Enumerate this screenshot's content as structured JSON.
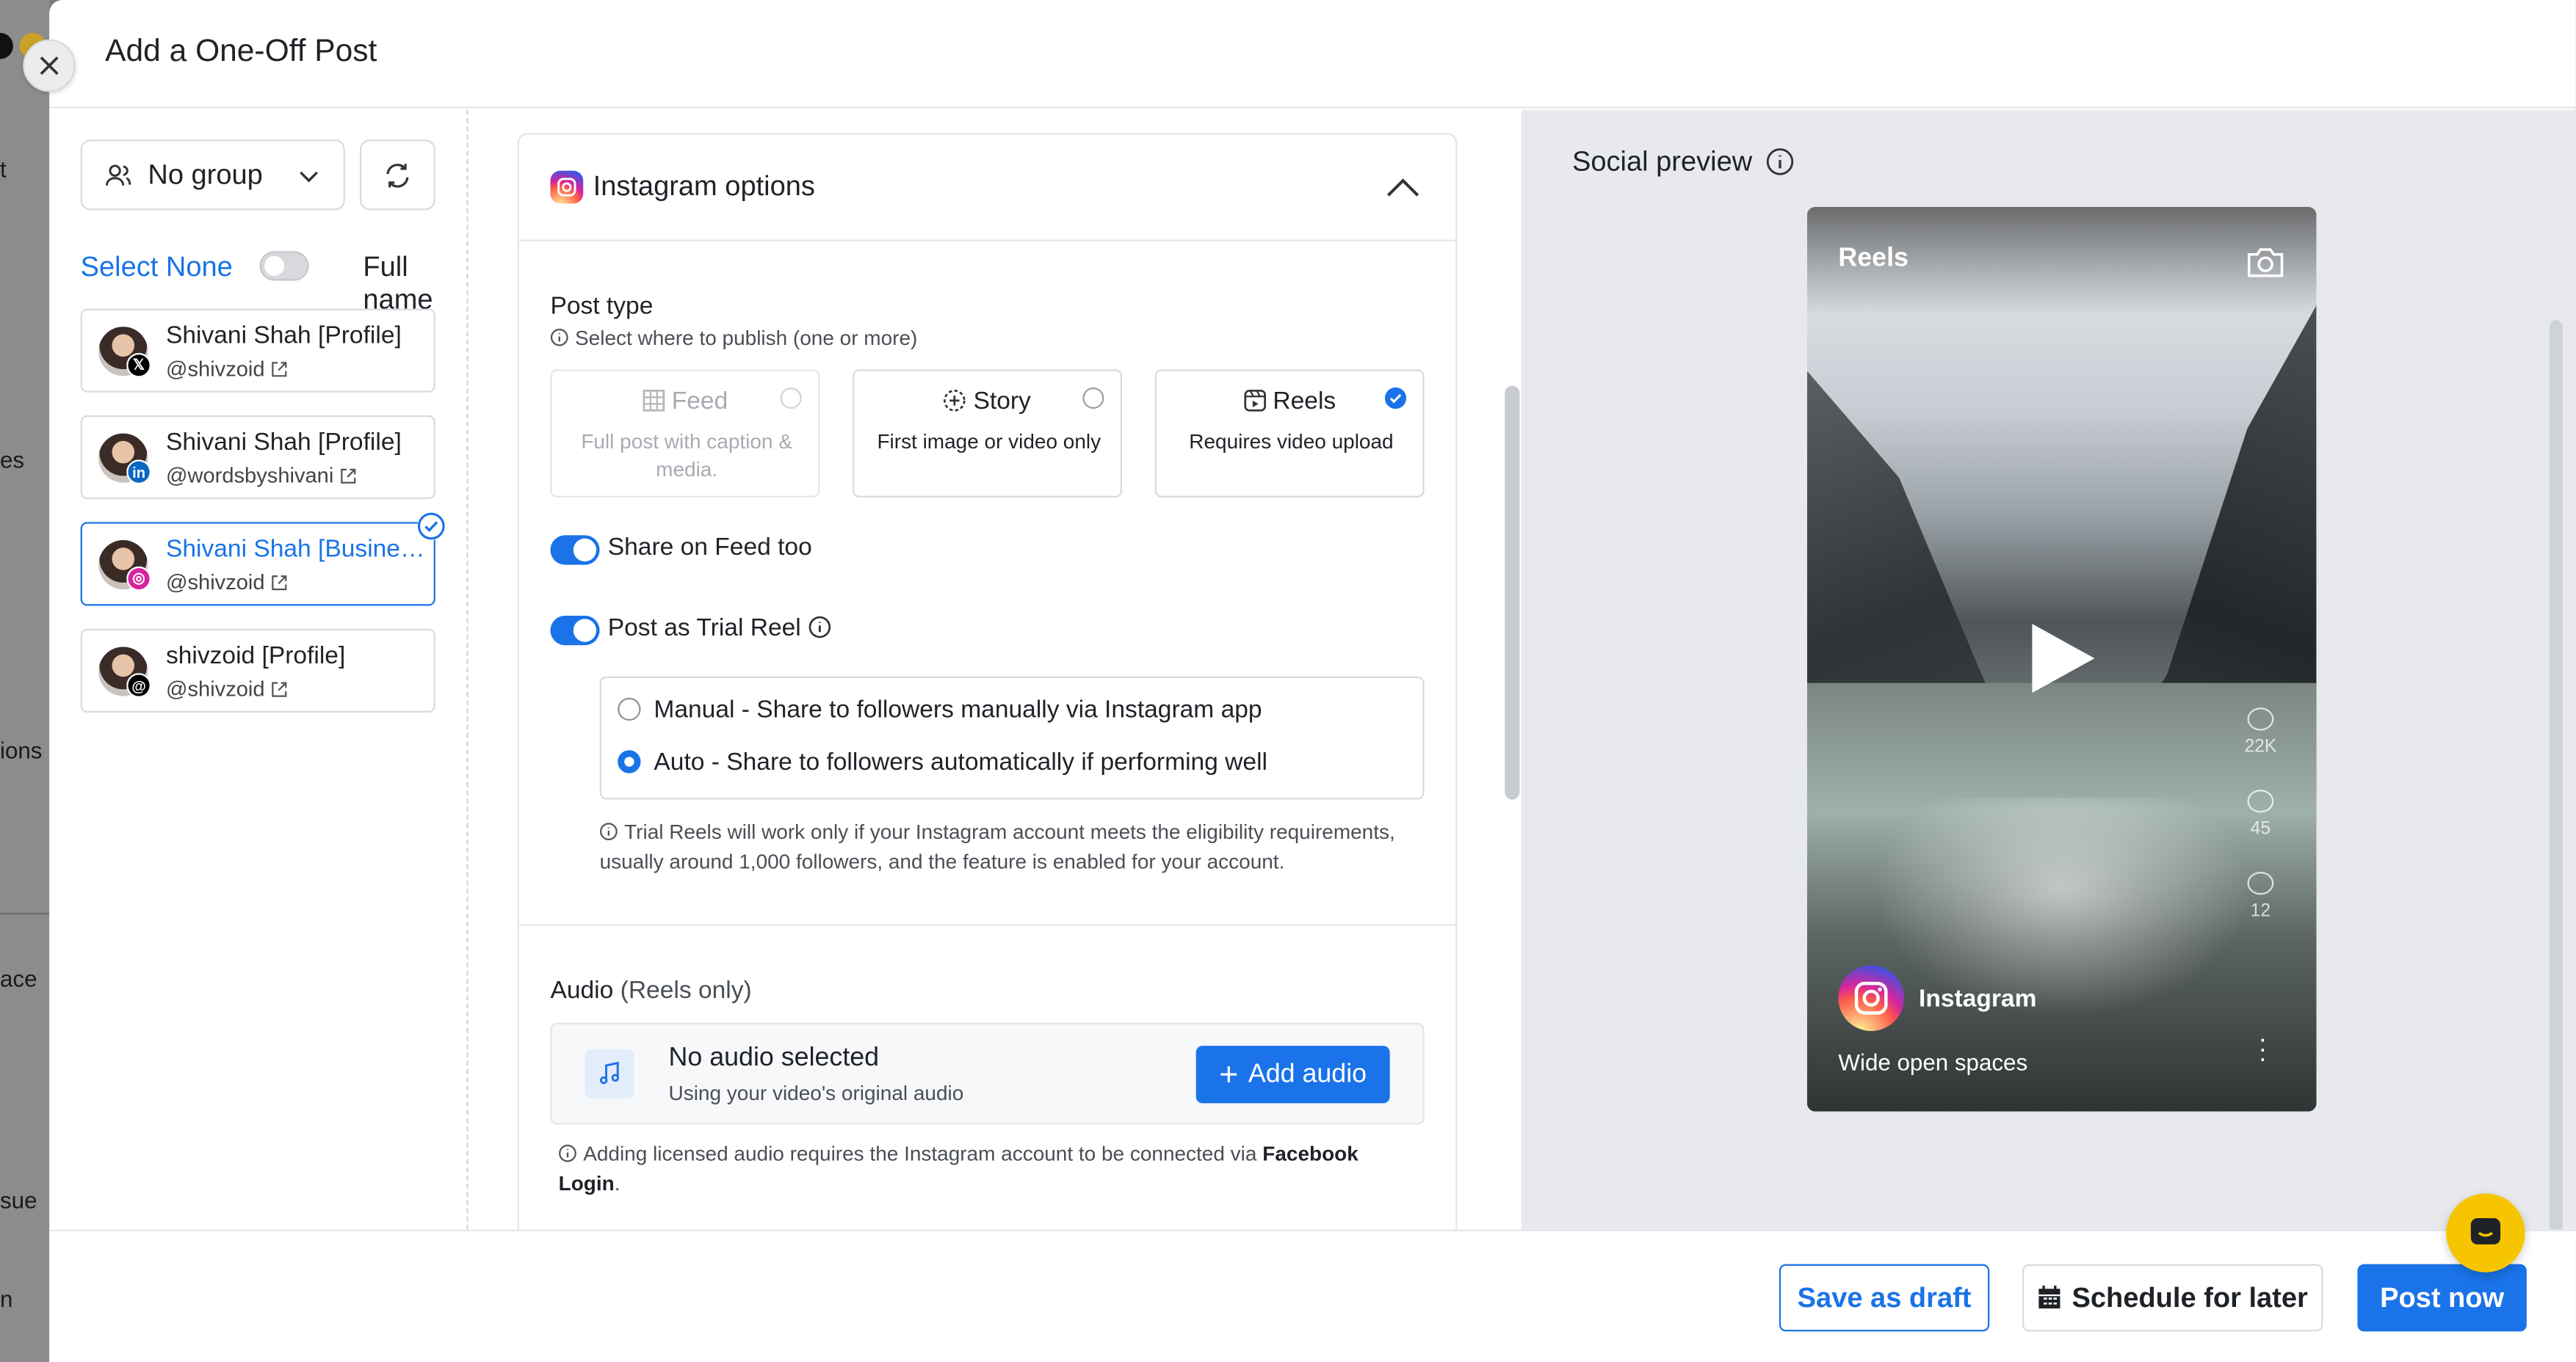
{
  "app": {
    "title": "Add a One-Off Post"
  },
  "background_fragments": [
    "t",
    "es",
    "ions",
    "ace",
    "sue",
    "n"
  ],
  "sidebar": {
    "group_select": {
      "value": "No group",
      "icon": "users-icon"
    },
    "select_none": "Select None",
    "full_name_toggle": {
      "label": "Full name",
      "on": false
    },
    "accounts": [
      {
        "name": "Shivani Shah [Profile]",
        "handle": "@shivzoid",
        "network": "X",
        "badge": "𝕏",
        "badge_color": "#000000",
        "selected": false
      },
      {
        "name": "Shivani Shah [Profile]",
        "handle": "@wordsbyshivani",
        "network": "LinkedIn",
        "badge": "in",
        "badge_color": "#0a66c2",
        "selected": false
      },
      {
        "name": "Shivani Shah [Business...",
        "handle": "@shivzoid",
        "network": "Instagram",
        "badge": "◎",
        "badge_color": "#d6249f",
        "selected": true
      },
      {
        "name": "shivzoid [Profile]",
        "handle": "@shivzoid",
        "network": "Threads",
        "badge": "@",
        "badge_color": "#000000",
        "selected": false
      }
    ]
  },
  "instagram_options": {
    "title": "Instagram options",
    "post_type": {
      "label": "Post type",
      "hint": "Select where to publish (one or more)",
      "options": [
        {
          "title": "Feed",
          "desc": "Full post with caption & media.",
          "enabled": false,
          "selected": false
        },
        {
          "title": "Story",
          "desc": "First image or video only",
          "enabled": true,
          "selected": false
        },
        {
          "title": "Reels",
          "desc": "Requires video upload",
          "enabled": true,
          "selected": true
        }
      ]
    },
    "share_on_feed": {
      "label": "Share on Feed too",
      "on": true
    },
    "trial_reel": {
      "label": "Post as Trial Reel",
      "on": true,
      "choices": [
        {
          "label": "Manual - Share to followers manually via Instagram app",
          "selected": false
        },
        {
          "label": "Auto - Share to followers automatically if performing well",
          "selected": true
        }
      ],
      "note": "Trial Reels will work only if your Instagram account meets the eligibility requirements, usually around 1,000 followers, and the feature is enabled for your account."
    },
    "audio": {
      "title": "Audio",
      "title_suffix": "(Reels only)",
      "status": "No audio selected",
      "sub": "Using your video's original audio",
      "add_label": "Add audio",
      "note_prefix": "Adding licensed audio requires the Instagram account to be connected via",
      "note_bold": "Facebook Login",
      "note_suffix": "."
    }
  },
  "preview": {
    "title": "Social preview",
    "reels_label": "Reels",
    "account_name": "Instagram",
    "caption": "Wide open spaces",
    "stats": [
      "22K",
      "45",
      "12"
    ]
  },
  "footer": {
    "save_draft": "Save as draft",
    "schedule": "Schedule for later",
    "post_now": "Post now"
  },
  "colors": {
    "accent": "#1a73e8",
    "chat": "#f7c500"
  }
}
